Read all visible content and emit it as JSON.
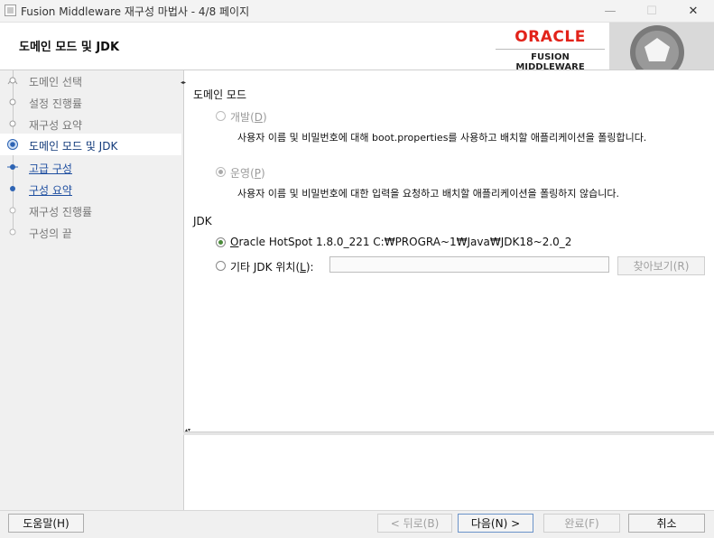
{
  "window": {
    "title": "Fusion Middleware 재구성 마법사 - 4/8 페이지",
    "minimize_glyph": "—",
    "maximize_glyph": "☐",
    "close_glyph": "✕"
  },
  "header": {
    "title": "도메인 모드 및 JDK",
    "logo_brand": "ORACLE",
    "logo_product": "FUSION MIDDLEWARE"
  },
  "nav": {
    "items": [
      {
        "label": "도메인 선택",
        "state": "done"
      },
      {
        "label": "설정 진행률",
        "state": "done"
      },
      {
        "label": "재구성 요약",
        "state": "done"
      },
      {
        "label": "도메인 모드 및 JDK",
        "state": "current"
      },
      {
        "label": "고급 구성",
        "state": "link"
      },
      {
        "label": "구성 요약",
        "state": "link"
      },
      {
        "label": "재구성 진행률",
        "state": "pending"
      },
      {
        "label": "구성의 끝",
        "state": "pending"
      }
    ]
  },
  "domain_mode": {
    "section_title": "도메인 모드",
    "dev_label_prefix": "개발(",
    "dev_mnemonic": "D",
    "dev_label_suffix": ")",
    "dev_desc": "사용자 이름 및 비밀번호에 대해 boot.properties를 사용하고 배치할 애플리케이션을 폴링합니다.",
    "prod_label_prefix": "운영(",
    "prod_mnemonic": "P",
    "prod_label_suffix": ")",
    "prod_desc": "사용자 이름 및 비밀번호에 대한 입력을 요청하고 배치할 애플리케이션을 폴링하지 않습니다.",
    "selected": "prod"
  },
  "jdk": {
    "section_title": "JDK",
    "oracle_mnemonic": "O",
    "oracle_label_rest": "racle HotSpot 1.8.0_221 C:₩PROGRA~1₩Java₩JDK18~2.0_2",
    "other_label_prefix": "기타 JDK 위치(",
    "other_mnemonic": "L",
    "other_label_suffix": "):",
    "other_path_value": "",
    "browse_label": "찾아보기(R)",
    "selected": "oracle"
  },
  "buttons": {
    "help": "도움말(H)",
    "back": "< 뒤로(B)",
    "next": "다음(N) >",
    "finish": "완료(F)",
    "cancel": "취소"
  },
  "colors": {
    "oracle_red": "#e2231a",
    "link_blue": "#1f4fa0",
    "radio_green": "#4a8a3a"
  }
}
